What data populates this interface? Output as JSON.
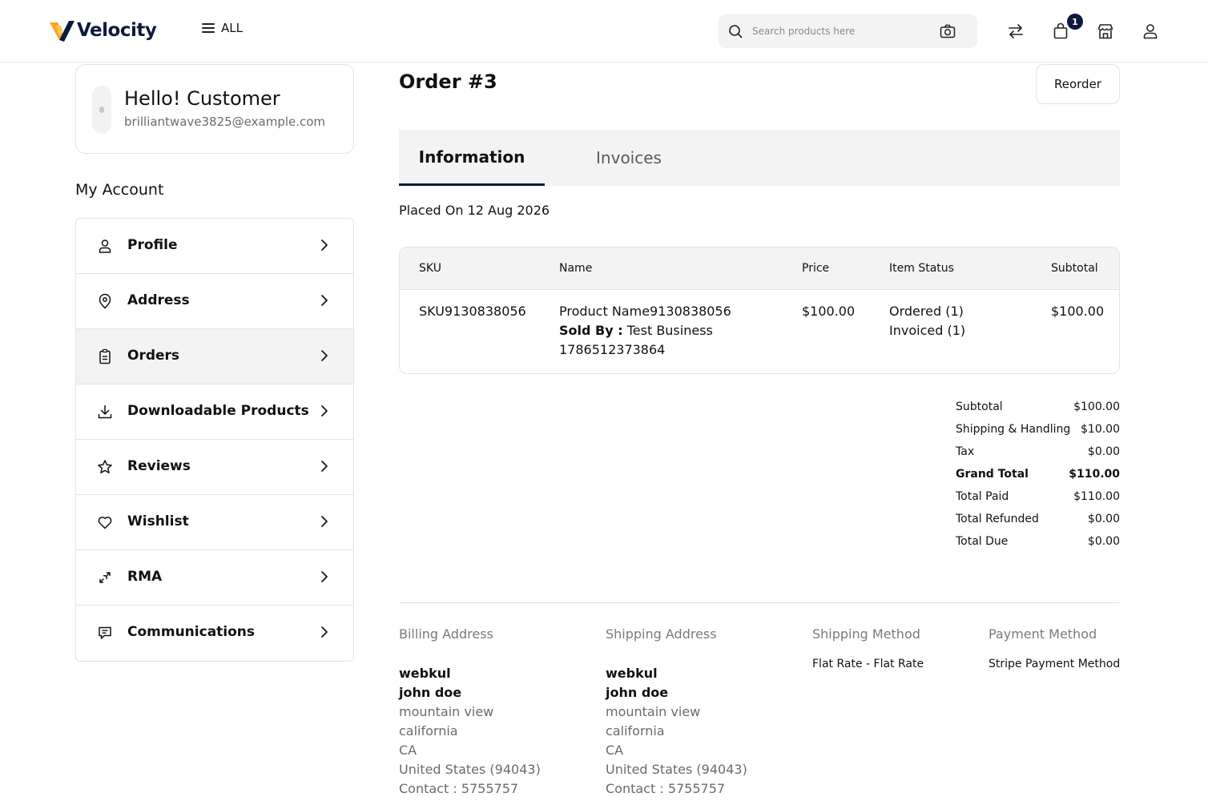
{
  "header": {
    "logo_text": "Velocity",
    "menu_label": "ALL",
    "search_placeholder": "Search products here",
    "cart_count": "1"
  },
  "customer": {
    "greeting": "Hello! Customer",
    "email": "brilliantwave3825@example.com"
  },
  "sidebar": {
    "title": "My Account",
    "items": [
      {
        "label": "Profile",
        "icon": "user-icon"
      },
      {
        "label": "Address",
        "icon": "location-pin-icon"
      },
      {
        "label": "Orders",
        "icon": "clipboard-icon",
        "active": true
      },
      {
        "label": "Downloadable Products",
        "icon": "download-icon"
      },
      {
        "label": "Reviews",
        "icon": "star-icon"
      },
      {
        "label": "Wishlist",
        "icon": "heart-icon"
      },
      {
        "label": "RMA",
        "icon": "return-icon"
      },
      {
        "label": "Communications",
        "icon": "message-icon"
      }
    ]
  },
  "order": {
    "title": "Order #3",
    "reorder_label": "Reorder",
    "tabs": [
      {
        "label": "Information"
      },
      {
        "label": "Invoices"
      }
    ],
    "placed_on": "Placed On 12 Aug 2026",
    "columns": {
      "sku": "SKU",
      "name": "Name",
      "price": "Price",
      "status": "Item Status",
      "subtotal": "Subtotal"
    },
    "items": [
      {
        "sku": "SKU9130838056",
        "name": "Product Name9130838056",
        "sold_by_label": "Sold By :",
        "sold_by": "Test Business",
        "seller_id": "1786512373864",
        "price": "$100.00",
        "status_ordered": "Ordered (1)",
        "status_invoiced": "Invoiced (1)",
        "subtotal": "$100.00"
      }
    ],
    "totals": [
      {
        "label": "Subtotal",
        "value": "$100.00"
      },
      {
        "label": "Shipping & Handling",
        "value": "$10.00"
      },
      {
        "label": "Tax",
        "value": "$0.00"
      },
      {
        "label": "Grand Total",
        "value": "$110.00",
        "bold": true
      },
      {
        "label": "Total Paid",
        "value": "$110.00"
      },
      {
        "label": "Total Refunded",
        "value": "$0.00"
      },
      {
        "label": "Total Due",
        "value": "$0.00"
      }
    ],
    "billing": {
      "heading": "Billing Address",
      "company": "webkul",
      "name": "john doe",
      "street": "mountain view",
      "city": "california",
      "state": "CA",
      "country": "United States (94043)",
      "contact": "Contact : 5755757"
    },
    "shipping": {
      "heading": "Shipping Address",
      "company": "webkul",
      "name": "john doe",
      "street": "mountain view",
      "city": "california",
      "state": "CA",
      "country": "United States (94043)",
      "contact": "Contact : 5755757"
    },
    "shipping_method": {
      "heading": "Shipping Method",
      "value": "Flat Rate - Flat Rate"
    },
    "payment_method": {
      "heading": "Payment Method",
      "value": "Stripe Payment Method"
    }
  },
  "colors": {
    "brand_navy": "#0c1a3d",
    "brand_orange": "#f5a623",
    "panel_bg": "#f3f3f3"
  }
}
